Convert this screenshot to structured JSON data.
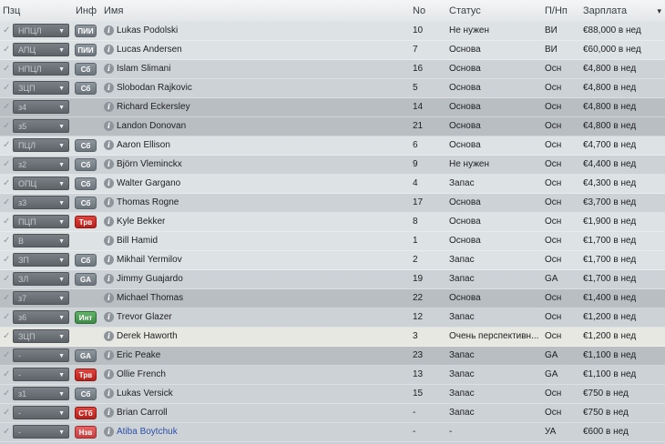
{
  "header": {
    "pos": "Пзц",
    "info": "Инф",
    "name": "Имя",
    "num": "No",
    "status": "Статус",
    "pn": "П/Нп",
    "salary": "Зарплата",
    "sort_icon": "▾"
  },
  "rows": [
    {
      "pos": "НПЦЛ",
      "badge": "ПИИ",
      "badge_color": "grey",
      "name": "Lukas Podolski",
      "num": "10",
      "status": "Не нужен",
      "pn": "ВИ",
      "salary": "€88,000 в нед",
      "shade": "light"
    },
    {
      "pos": "АПЦ",
      "badge": "ПИИ",
      "badge_color": "grey",
      "name": "Lucas Andersen",
      "num": "7",
      "status": "Основа",
      "pn": "ВИ",
      "salary": "€60,000 в нед",
      "shade": "light"
    },
    {
      "pos": "НПЦЛ",
      "badge": "Сб",
      "badge_color": "grey",
      "name": "Islam Slimani",
      "num": "16",
      "status": "Основа",
      "pn": "Осн",
      "salary": "€4,800 в нед",
      "shade": "mid"
    },
    {
      "pos": "ЗЦП",
      "badge": "Сб",
      "badge_color": "grey",
      "name": "Slobodan Rajkovic",
      "num": "5",
      "status": "Основа",
      "pn": "Осн",
      "salary": "€4,800 в нед",
      "shade": "mid"
    },
    {
      "pos": "з4",
      "badge": "",
      "badge_color": "",
      "name": "Richard Eckersley",
      "num": "14",
      "status": "Основа",
      "pn": "Осн",
      "salary": "€4,800 в нед",
      "shade": "dark"
    },
    {
      "pos": "з5",
      "badge": "",
      "badge_color": "",
      "name": "Landon Donovan",
      "num": "21",
      "status": "Основа",
      "pn": "Осн",
      "salary": "€4,800 в нед",
      "shade": "dark"
    },
    {
      "pos": "ПЦЛ",
      "badge": "Сб",
      "badge_color": "grey",
      "name": "Aaron Ellison",
      "num": "6",
      "status": "Основа",
      "pn": "Осн",
      "salary": "€4,700 в нед",
      "shade": "light"
    },
    {
      "pos": "з2",
      "badge": "Сб",
      "badge_color": "grey",
      "name": "Björn Vleminckx",
      "num": "9",
      "status": "Не нужен",
      "pn": "Осн",
      "salary": "€4,400 в нед",
      "shade": "mid"
    },
    {
      "pos": "ОПЦ",
      "badge": "Сб",
      "badge_color": "grey",
      "name": "Walter Gargano",
      "num": "4",
      "status": "Запас",
      "pn": "Осн",
      "salary": "€4,300 в нед",
      "shade": "light"
    },
    {
      "pos": "з3",
      "badge": "Сб",
      "badge_color": "grey",
      "name": "Thomas Rogne",
      "num": "17",
      "status": "Основа",
      "pn": "Осн",
      "salary": "€3,700 в нед",
      "shade": "mid"
    },
    {
      "pos": "ПЦП",
      "badge": "Трв",
      "badge_color": "red",
      "name": "Kyle Bekker",
      "num": "8",
      "status": "Основа",
      "pn": "Осн",
      "salary": "€1,900 в нед",
      "shade": "light"
    },
    {
      "pos": "В",
      "badge": "",
      "badge_color": "",
      "name": "Bill Hamid",
      "num": "1",
      "status": "Основа",
      "pn": "Осн",
      "salary": "€1,700 в нед",
      "shade": "light"
    },
    {
      "pos": "ЗП",
      "badge": "Сб",
      "badge_color": "grey",
      "name": "Mikhail Yermilov",
      "num": "2",
      "status": "Запас",
      "pn": "Осн",
      "salary": "€1,700 в нед",
      "shade": "light"
    },
    {
      "pos": "ЗЛ",
      "badge": "GA",
      "badge_color": "grey",
      "name": "Jimmy Guajardo",
      "num": "19",
      "status": "Запас",
      "pn": "GA",
      "salary": "€1,700 в нед",
      "shade": "mid"
    },
    {
      "pos": "з7",
      "badge": "",
      "badge_color": "",
      "name": "Michael Thomas",
      "num": "22",
      "status": "Основа",
      "pn": "Осн",
      "salary": "€1,400 в нед",
      "shade": "dark"
    },
    {
      "pos": "з6",
      "badge": "Инт",
      "badge_color": "green",
      "name": "Trevor Glazer",
      "num": "12",
      "status": "Запас",
      "pn": "Осн",
      "salary": "€1,200 в нед",
      "shade": "mid"
    },
    {
      "pos": "ЗЦП",
      "badge": "",
      "badge_color": "",
      "name": "Derek Haworth",
      "num": "3",
      "status": "Очень перспективн...",
      "pn": "Осн",
      "salary": "€1,200 в нед",
      "shade": "cream"
    },
    {
      "pos": "-",
      "badge": "GA",
      "badge_color": "grey",
      "name": "Eric Peake",
      "num": "23",
      "status": "Запас",
      "pn": "GA",
      "salary": "€1,100 в нед",
      "shade": "dark"
    },
    {
      "pos": "-",
      "badge": "Трв",
      "badge_color": "red",
      "name": "Ollie French",
      "num": "13",
      "status": "Запас",
      "pn": "GA",
      "salary": "€1,100 в нед",
      "shade": "mid"
    },
    {
      "pos": "з1",
      "badge": "Сб",
      "badge_color": "grey",
      "name": "Lukas Versick",
      "num": "15",
      "status": "Запас",
      "pn": "Осн",
      "salary": "€750 в нед",
      "shade": "mid"
    },
    {
      "pos": "-",
      "badge": "СТб",
      "badge_color": "red",
      "name": "Brian Carroll",
      "num": "-",
      "status": "Запас",
      "pn": "Осн",
      "salary": "€750 в нед",
      "shade": "mid"
    },
    {
      "pos": "-",
      "badge": "Нзв",
      "badge_color": "pink",
      "name": "Atiba Boytchuk",
      "num": "-",
      "status": "-",
      "pn": "УА",
      "salary": "€600 в нед",
      "shade": "mid",
      "name_color": "blue"
    }
  ]
}
